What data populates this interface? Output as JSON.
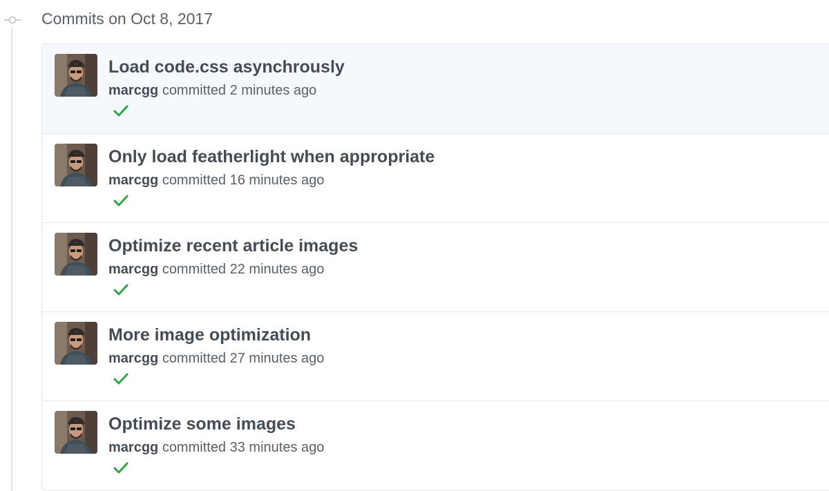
{
  "header": {
    "title": "Commits on Oct 8, 2017",
    "icon": "git-commit-icon"
  },
  "commits": [
    {
      "title": "Load code.css asynchrously",
      "author": "marcgg",
      "verb": "committed",
      "time": "2 minutes ago",
      "status": "success"
    },
    {
      "title": "Only load featherlight when appropriate",
      "author": "marcgg",
      "verb": "committed",
      "time": "16 minutes ago",
      "status": "success"
    },
    {
      "title": "Optimize recent article images",
      "author": "marcgg",
      "verb": "committed",
      "time": "22 minutes ago",
      "status": "success"
    },
    {
      "title": "More image optimization",
      "author": "marcgg",
      "verb": "committed",
      "time": "27 minutes ago",
      "status": "success"
    },
    {
      "title": "Optimize some images",
      "author": "marcgg",
      "verb": "committed",
      "time": "33 minutes ago",
      "status": "success"
    }
  ],
  "colors": {
    "highlight_row": "#f5f9fd",
    "success": "#28a745",
    "border": "#e1e4e8"
  }
}
